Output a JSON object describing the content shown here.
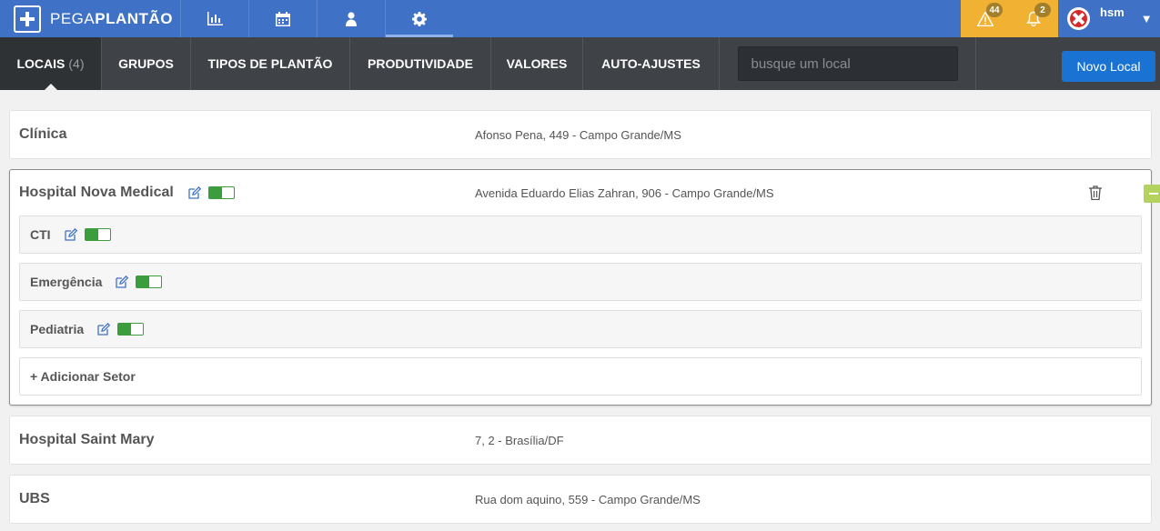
{
  "brand": {
    "name_light": "PEGA",
    "name_bold": "PLANTÃO"
  },
  "topnav": [
    {
      "icon": "bar-chart-icon"
    },
    {
      "icon": "calendar-icon"
    },
    {
      "icon": "user-icon"
    },
    {
      "icon": "gear-icon",
      "active": true
    }
  ],
  "notifications": {
    "alerts_count": "44",
    "bell_count": "2"
  },
  "user": {
    "name": "hsm",
    "caret": "▼"
  },
  "subnav": {
    "tabs": [
      {
        "label": "LOCAIS",
        "count": "(4)",
        "active": true
      },
      {
        "label": "GRUPOS"
      },
      {
        "label": "TIPOS DE PLANTÃO"
      },
      {
        "label": "PRODUTIVIDADE"
      },
      {
        "label": "VALORES"
      },
      {
        "label": "AUTO-AJUSTES"
      }
    ],
    "search_placeholder": "busque um local",
    "new_button": "Novo Local"
  },
  "locations": [
    {
      "name": "Clínica",
      "address": "Afonso Pena, 449 - Campo Grande/MS"
    },
    {
      "name": "Hospital Nova Medical",
      "address": "Avenida Eduardo Elias Zahran, 906 - Campo Grande/MS",
      "expanded": true,
      "sectors": [
        {
          "name": "CTI"
        },
        {
          "name": "Emergência"
        },
        {
          "name": "Pediatria"
        }
      ],
      "add_sector": "+ Adicionar Setor"
    },
    {
      "name": "Hospital Saint Mary",
      "address": "7, 2 - Brasília/DF"
    },
    {
      "name": "UBS",
      "address": "Rua dom aquino, 559 - Campo Grande/MS"
    }
  ],
  "colors": {
    "topbar": "#3f72c6",
    "subbar": "#3f4347",
    "accent_button": "#1a73d3",
    "notif_bg": "#f1b233",
    "toggle_on": "#3c9d3c",
    "collapse": "#b3d25e"
  }
}
